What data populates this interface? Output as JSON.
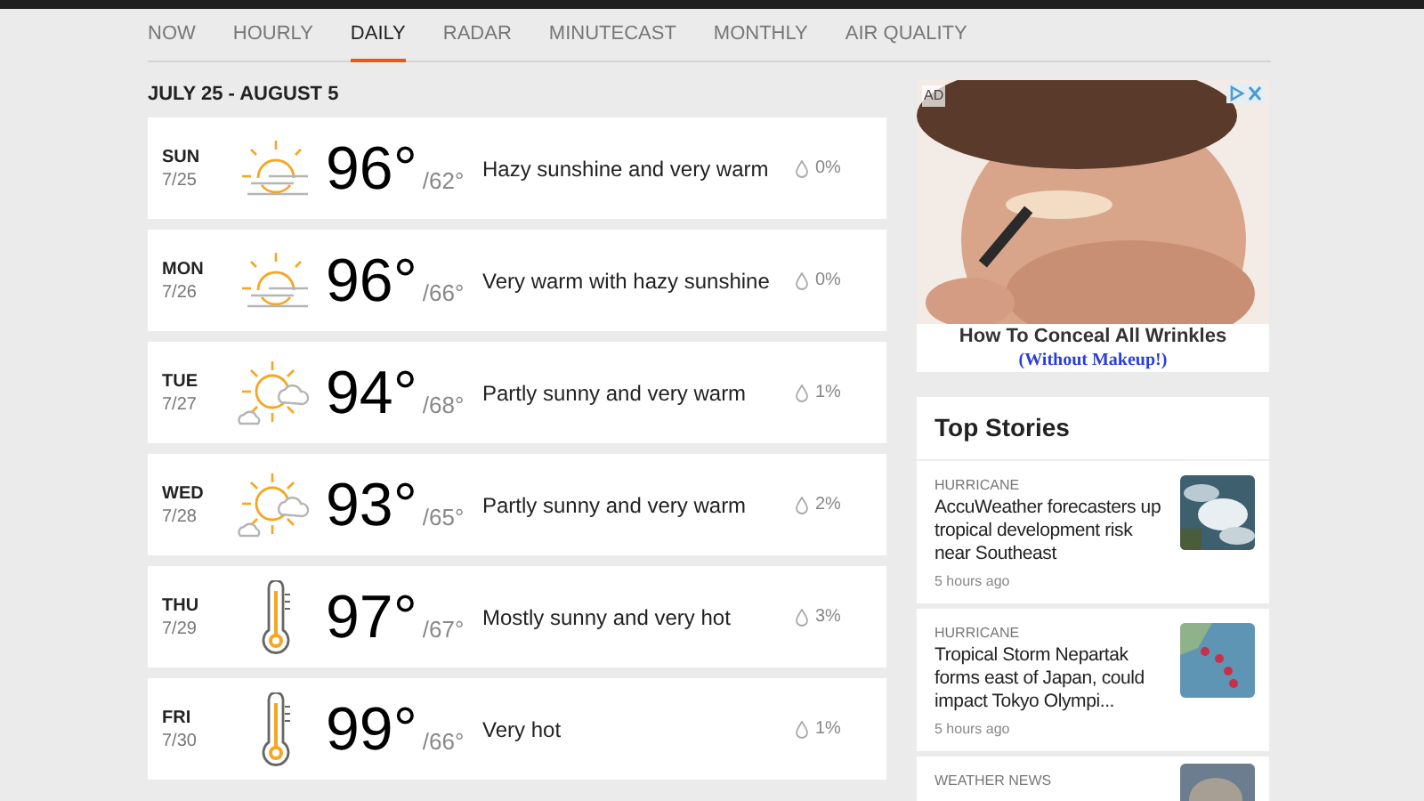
{
  "tabs": [
    {
      "label": "NOW",
      "selected": false
    },
    {
      "label": "HOURLY",
      "selected": false
    },
    {
      "label": "DAILY",
      "selected": true
    },
    {
      "label": "RADAR",
      "selected": false
    },
    {
      "label": "MINUTECAST",
      "selected": false
    },
    {
      "label": "MONTHLY",
      "selected": false
    },
    {
      "label": "AIR QUALITY",
      "selected": false
    }
  ],
  "date_range": "JULY 25 - AUGUST 5",
  "days": [
    {
      "day": "SUN",
      "date": "7/25",
      "kind": "hazy",
      "high": "96°",
      "low": "/62°",
      "phrase": "Hazy sunshine and very warm",
      "precip": "0%"
    },
    {
      "day": "MON",
      "date": "7/26",
      "kind": "hazy",
      "high": "96°",
      "low": "/66°",
      "phrase": "Very warm with hazy sunshine",
      "precip": "0%"
    },
    {
      "day": "TUE",
      "date": "7/27",
      "kind": "partly-sunny",
      "high": "94°",
      "low": "/68°",
      "phrase": "Partly sunny and very warm",
      "precip": "1%"
    },
    {
      "day": "WED",
      "date": "7/28",
      "kind": "partly-sunny",
      "high": "93°",
      "low": "/65°",
      "phrase": "Partly sunny and very warm",
      "precip": "2%"
    },
    {
      "day": "THU",
      "date": "7/29",
      "kind": "hot",
      "high": "97°",
      "low": "/67°",
      "phrase": "Mostly sunny and very hot",
      "precip": "3%"
    },
    {
      "day": "FRI",
      "date": "7/30",
      "kind": "hot",
      "high": "99°",
      "low": "/66°",
      "phrase": "Very hot",
      "precip": "1%"
    }
  ],
  "ad": {
    "badge": "AD",
    "headline": "How To Conceal All Wrinkles",
    "subline": "(Without Makeup!)"
  },
  "top_stories": {
    "title": "Top Stories",
    "items": [
      {
        "category": "HURRICANE",
        "headline": "AccuWeather forecasters up tropical development risk near Southeast",
        "time": "5 hours ago"
      },
      {
        "category": "HURRICANE",
        "headline": "Tropical Storm Nepartak forms east of Japan, could impact Tokyo Olympi...",
        "time": "5 hours ago"
      },
      {
        "category": "WEATHER NEWS"
      }
    ]
  }
}
